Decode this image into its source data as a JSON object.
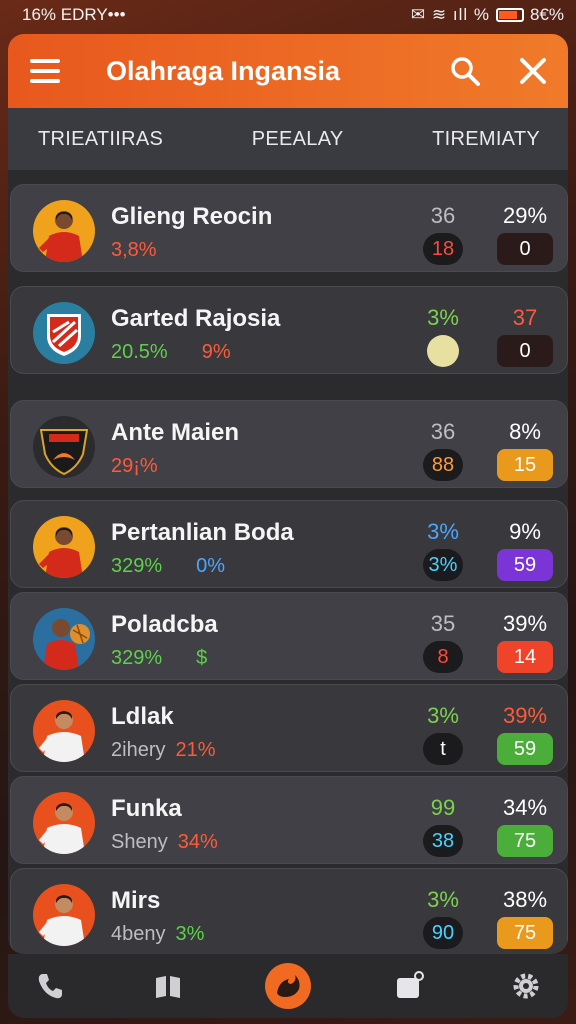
{
  "status": {
    "left": "16% EDRY•••",
    "right": "✹⁠ 8£8%",
    "battery_pct": 0.7
  },
  "header": {
    "title": "Olahraga Ingansia"
  },
  "tabs": [
    "TRIEATIIRAS",
    "PEEALAY",
    "TIREMIATY"
  ],
  "rows": [
    {
      "name": "Glieng Reocin",
      "sub1": "3,8%",
      "sub1_color": "#ff5a3a",
      "sub2": "",
      "stat1": "36",
      "stat1_color": "#bdbdc2",
      "pill1": "18",
      "pill1_color": "#ff4a3a",
      "stat2": "29%",
      "stat2_color": "#ffffff",
      "pill2": "0",
      "pill2_bg": "#2a1a1a",
      "pill2_color": "#ffffff",
      "avatar": "player-red"
    },
    {
      "name": "Garted Rajosia",
      "sub1": "20.5%",
      "sub1_color": "#5ed04a",
      "sub2": "9%",
      "stat1": "3%",
      "stat1_color": "#7cd24e",
      "pill1": "",
      "pill1_color": "#e8e0a0",
      "stat2": "37",
      "stat2_color": "#ff5a3a",
      "pill2": "0",
      "pill2_bg": "#2a1a1a",
      "pill2_color": "#ffffff",
      "avatar": "club-crest"
    },
    {
      "name": "Ante Maien",
      "sub1": "29¡%",
      "sub1_color": "#ff5a3a",
      "sub2": "",
      "stat1": "36",
      "stat1_color": "#bdbdc2",
      "pill1": "88",
      "pill1_color": "#ff9a3a",
      "stat2": "8%",
      "stat2_color": "#ffffff",
      "pill2": "15",
      "pill2_bg": "#e99a1c",
      "pill2_color": "#ffffff",
      "avatar": "club-shield"
    },
    {
      "name": "Pertanlian Boda",
      "sub1": "329%",
      "sub1_color": "#5ed04a",
      "sub2": "0%",
      "stat1": "3%",
      "stat1_color": "#4aa6ff",
      "pill1": "3%",
      "pill1_color": "#4ad2ff",
      "stat2": "9%",
      "stat2_color": "#ffffff",
      "pill2": "59",
      "pill2_bg": "#7b35d6",
      "pill2_color": "#ffffff",
      "avatar": "player-red"
    },
    {
      "name": "Poladcba",
      "sub1": "329%",
      "sub1_color": "#5ed04a",
      "sub2": "$",
      "stat1": "35",
      "stat1_color": "#bdbdc2",
      "pill1": "8",
      "pill1_color": "#ff4a3a",
      "stat2": "39%",
      "stat2_color": "#ffffff",
      "pill2": "14",
      "pill2_bg": "#f0442a",
      "pill2_color": "#ffffff",
      "avatar": "player-ball"
    },
    {
      "name": "Ldlak",
      "sub1": "2ihery",
      "sub1_color": "#bdbdc2",
      "sub2": "21%",
      "stat1": "3%",
      "stat1_color": "#7cd24e",
      "pill1": "t",
      "pill1_color": "#ffffff",
      "stat2": "39%",
      "stat2_color": "#ff5a3a",
      "pill2": "59",
      "pill2_bg": "#4cae3a",
      "pill2_color": "#ffffff",
      "avatar": "player-white"
    },
    {
      "name": "Funka",
      "sub1": "Sheny",
      "sub1_color": "#bdbdc2",
      "sub2": "34%",
      "stat1": "99",
      "stat1_color": "#7cd24e",
      "pill1": "38",
      "pill1_color": "#4ad2ff",
      "stat2": "34%",
      "stat2_color": "#ffffff",
      "pill2": "75",
      "pill2_bg": "#4cae3a",
      "pill2_color": "#ffffff",
      "avatar": "player-white"
    },
    {
      "name": "Mirs",
      "sub1": "4beny",
      "sub1_color": "#bdbdc2",
      "sub2": "3%",
      "stat1": "3%",
      "stat1_color": "#7cd24e",
      "pill1": "90",
      "pill1_color": "#4ad2ff",
      "stat2": "38%",
      "stat2_color": "#ffffff",
      "pill2": "75",
      "pill2_bg": "#e99a1c",
      "pill2_color": "#ffffff",
      "avatar": "player-white"
    }
  ],
  "nav": [
    "phone-icon",
    "book-icon",
    "fire-icon",
    "note-icon",
    "gear-icon"
  ]
}
